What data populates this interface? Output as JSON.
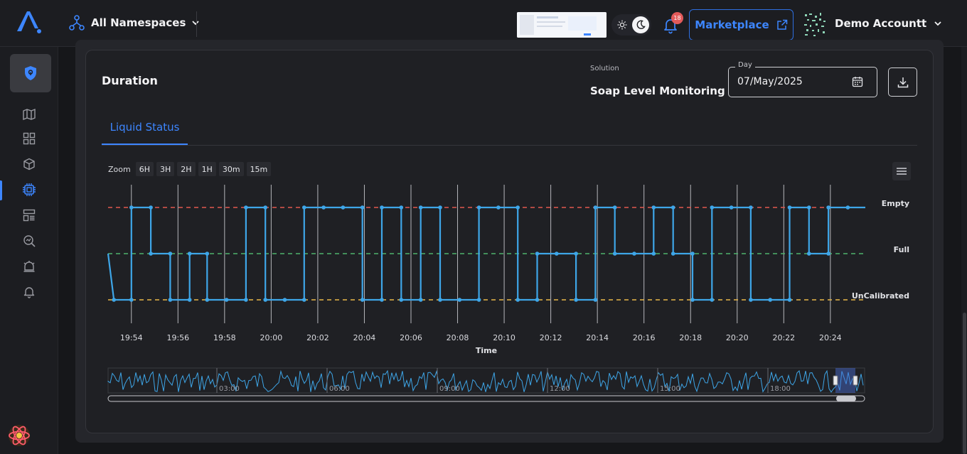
{
  "header": {
    "namespace_label": "All Namespaces",
    "notification_count": "18",
    "marketplace_label": "Marketplace",
    "account_name": "Demo Accountt"
  },
  "sidebar": {
    "items": [
      "shield-icon",
      "map-icon",
      "dashboard-icon",
      "cube-icon",
      "chip-icon",
      "layout-icon",
      "search-analytics-icon",
      "alarm-icon",
      "bell-icon"
    ],
    "active_index": 4
  },
  "card": {
    "title": "Duration",
    "solution_label": "Solution",
    "solution_value": "Soap Level Monitoring",
    "day_label": "Day",
    "day_value": "07/May/2025",
    "tab_label": "Liquid Status"
  },
  "zoom": {
    "label": "Zoom",
    "buttons": [
      "6H",
      "3H",
      "2H",
      "1H",
      "30m",
      "15m"
    ]
  },
  "colors": {
    "accent": "#3d86ff",
    "series": "#3ea6e8",
    "empty_line": "#e0584f",
    "full_line": "#4fb36c",
    "uncalibrated_line": "#e8b84a"
  },
  "chart_data": {
    "type": "line",
    "xlabel": "Time",
    "ylabel": "",
    "x_ticks": [
      "19:54",
      "19:56",
      "19:58",
      "20:00",
      "20:02",
      "20:04",
      "20:06",
      "20:08",
      "20:10",
      "20:12",
      "20:14",
      "20:16",
      "20:18",
      "20:20",
      "20:22",
      "20:24"
    ],
    "y_categories": [
      "UnCalibrated",
      "Full",
      "Empty"
    ],
    "xlim": [
      "19:53:00",
      "20:25:30"
    ],
    "step": "start",
    "grid": true,
    "series": [
      {
        "values": [
          [
            "19:53:00",
            "Full"
          ],
          [
            "19:53:15",
            "UnCalibrated"
          ],
          [
            "19:54:00",
            "UnCalibrated"
          ],
          [
            "19:54:00",
            "Empty"
          ],
          [
            "19:54:50",
            "Empty"
          ],
          [
            "19:54:50",
            "Full"
          ],
          [
            "19:55:40",
            "Full"
          ],
          [
            "19:55:40",
            "UnCalibrated"
          ],
          [
            "19:56:30",
            "UnCalibrated"
          ],
          [
            "19:56:30",
            "Full"
          ],
          [
            "19:57:15",
            "Full"
          ],
          [
            "19:57:15",
            "UnCalibrated"
          ],
          [
            "19:58:05",
            "UnCalibrated"
          ],
          [
            "19:58:55",
            "UnCalibrated"
          ],
          [
            "19:58:55",
            "Empty"
          ],
          [
            "19:59:45",
            "Empty"
          ],
          [
            "19:59:45",
            "UnCalibrated"
          ],
          [
            "20:00:35",
            "UnCalibrated"
          ],
          [
            "20:01:25",
            "UnCalibrated"
          ],
          [
            "20:01:25",
            "Empty"
          ],
          [
            "20:02:15",
            "Empty"
          ],
          [
            "20:03:05",
            "Empty"
          ],
          [
            "20:03:55",
            "Empty"
          ],
          [
            "20:03:55",
            "UnCalibrated"
          ],
          [
            "20:04:45",
            "UnCalibrated"
          ],
          [
            "20:04:45",
            "Empty"
          ],
          [
            "20:05:35",
            "Empty"
          ],
          [
            "20:05:35",
            "UnCalibrated"
          ],
          [
            "20:06:25",
            "UnCalibrated"
          ],
          [
            "20:06:25",
            "Empty"
          ],
          [
            "20:07:15",
            "Empty"
          ],
          [
            "20:07:15",
            "UnCalibrated"
          ],
          [
            "20:08:05",
            "UnCalibrated"
          ],
          [
            "20:08:55",
            "UnCalibrated"
          ],
          [
            "20:08:55",
            "Empty"
          ],
          [
            "20:09:45",
            "Empty"
          ],
          [
            "20:10:35",
            "Empty"
          ],
          [
            "20:10:35",
            "UnCalibrated"
          ],
          [
            "20:11:25",
            "UnCalibrated"
          ],
          [
            "20:11:25",
            "Full"
          ],
          [
            "20:12:15",
            "Full"
          ],
          [
            "20:13:05",
            "Full"
          ],
          [
            "20:13:05",
            "UnCalibrated"
          ],
          [
            "20:13:55",
            "UnCalibrated"
          ],
          [
            "20:13:55",
            "Empty"
          ],
          [
            "20:14:45",
            "Empty"
          ],
          [
            "20:14:45",
            "Full"
          ],
          [
            "20:15:35",
            "Full"
          ],
          [
            "20:16:25",
            "Full"
          ],
          [
            "20:16:25",
            "Empty"
          ],
          [
            "20:17:15",
            "Empty"
          ],
          [
            "20:17:15",
            "Full"
          ],
          [
            "20:18:05",
            "Full"
          ],
          [
            "20:18:05",
            "UnCalibrated"
          ],
          [
            "20:18:55",
            "UnCalibrated"
          ],
          [
            "20:18:55",
            "Empty"
          ],
          [
            "20:19:45",
            "Empty"
          ],
          [
            "20:20:35",
            "Empty"
          ],
          [
            "20:20:35",
            "UnCalibrated"
          ],
          [
            "20:21:25",
            "UnCalibrated"
          ],
          [
            "20:22:15",
            "UnCalibrated"
          ],
          [
            "20:22:15",
            "Empty"
          ],
          [
            "20:23:05",
            "Empty"
          ],
          [
            "20:23:05",
            "Full"
          ],
          [
            "20:23:55",
            "Full"
          ],
          [
            "20:23:55",
            "Empty"
          ],
          [
            "20:24:45",
            "Empty"
          ],
          [
            "20:25:30",
            "Empty"
          ]
        ]
      }
    ],
    "navigator": {
      "x_ticks": [
        "03:00",
        "06:00",
        "09:00",
        "12:00",
        "15:00",
        "18:00"
      ],
      "selected_range": [
        "19:53",
        "20:25"
      ]
    }
  }
}
